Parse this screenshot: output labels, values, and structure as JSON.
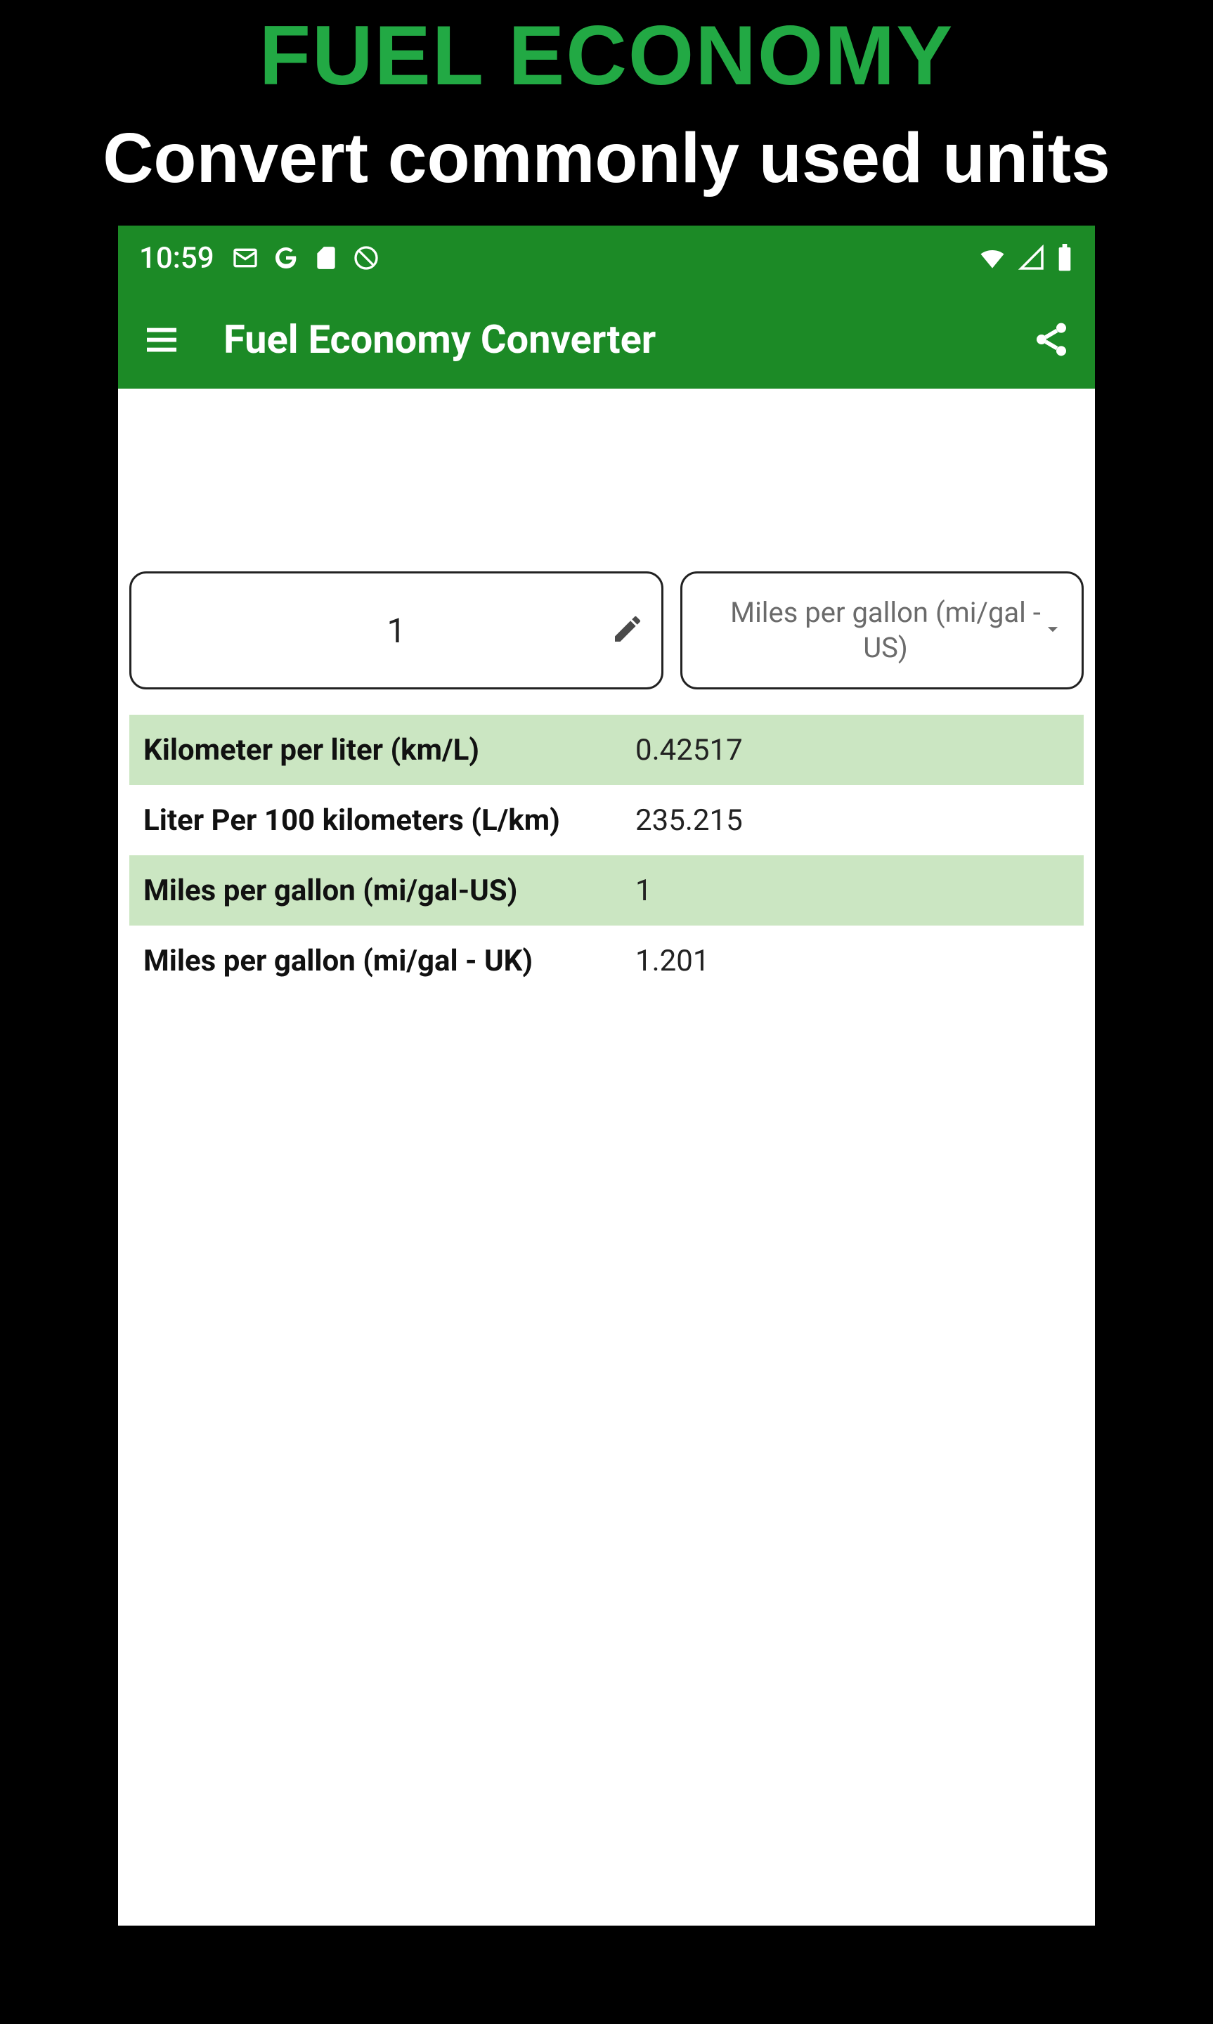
{
  "promo": {
    "title": "FUEL ECONOMY",
    "subtitle": "Convert commonly used units"
  },
  "statusbar": {
    "time": "10:59"
  },
  "appbar": {
    "title": "Fuel Economy Converter"
  },
  "input": {
    "value": "1",
    "unit_label": "Miles per gallon (mi/gal - US)"
  },
  "rows": [
    {
      "label": "Kilometer per liter (km/L)",
      "value": "0.42517"
    },
    {
      "label": "Liter Per 100 kilometers (L/km)",
      "value": "235.215"
    },
    {
      "label": "Miles per gallon (mi/gal-US)",
      "value": "1"
    },
    {
      "label": "Miles per gallon (mi/gal - UK)",
      "value": "1.201"
    }
  ]
}
